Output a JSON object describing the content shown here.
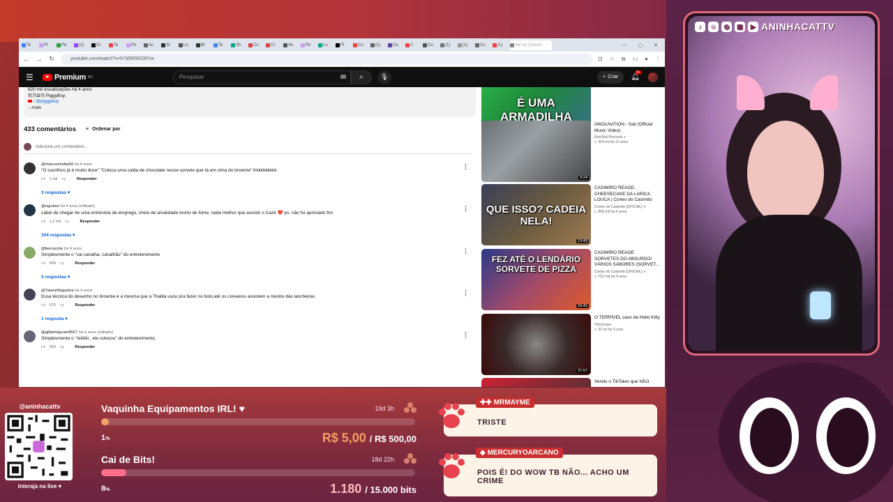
{
  "browser": {
    "tabs": [
      "Te",
      "Pl",
      "Pe",
      "(1)",
      "Gi",
      "Te",
      "Pe",
      "Ac",
      "St",
      "Lo",
      "Bl",
      "Te",
      "Sh",
      "Co",
      "Cr",
      "Ve",
      "Pe",
      "Lo",
      "Pi",
      "Co",
      "(1)",
      "Ce",
      "2:",
      "Co",
      "(1)",
      "(1)",
      "Co",
      "(1)"
    ],
    "active_tab": "Ver no Gemini",
    "url": "youtube.com/watch?v=h7d5R9XD9Yw"
  },
  "youtube": {
    "logo_text": "Premium",
    "logo_sup": "BR",
    "search_placeholder": "Pesquisar",
    "create_label": "Criar",
    "notif_badge": "9+",
    "description": {
      "views": "820 mil visualizações  há 4 anos",
      "line2": "피기보이 PiggyBoy:",
      "handle": "/ @piggyboy",
      "more": "...mais"
    },
    "comments_count": "433 comentários",
    "sort_label": "Ordenar por",
    "add_comment_placeholder": "Adicione um comentário...",
    "reply_label": "Responder",
    "comments": [
      {
        "author": "@marcosmotta94",
        "time": "há 4 anos",
        "text": "\"O sucrilhos já é muito doce\" \"Coloca uma calda de chocolate nesse sorvete que tá em cima do brownie\" Kkkkkkkkkk",
        "likes": "1 mil",
        "replies": "3 respostas"
      },
      {
        "author": "@ngcdavi",
        "time": "há 4 anos (editado)",
        "text": "cabei de chegar de uma entrevista de emprego, cheio de ansiedade morto de fome, nada melhor que assistir o Cazé ❤️ ps: não fui aprovado fml",
        "likes": "1,2 mil",
        "replies": "104 respostas"
      },
      {
        "author": "@bercacola",
        "time": "há 4 anos",
        "text": "Simplesmente o \"vai canalha, canalhão\" do entretenimento",
        "likes": "609",
        "replies": "3 respostas"
      },
      {
        "author": "@TaianeNogueira",
        "time": "há 4 anos",
        "text": "Essa técnica do desenho no brownie é a mesma que a Thalita usou pra fazer no bolo,até os coreanos assistem a mestre das lancheiras",
        "likes": "570",
        "replies": "1 resposta"
      },
      {
        "author": "@gilbertojunior8567",
        "time": "há 4 anos (editado)",
        "text": "Simplesmente o \"Aiiiiiiiii , ele colocou\" do entretenimento.",
        "likes": "554",
        "replies": ""
      }
    ],
    "recommendations": [
      {
        "title": "",
        "channel": "",
        "stats": "",
        "duration": "14:14",
        "thumb_text": "É UMA ARMADILHA"
      },
      {
        "title": "AWOLNATION - Sail (Official Music Video)",
        "channel": "Red Bull Records ✔",
        "stats": "▷ 364 mi  há 12 anos",
        "duration": "4:24",
        "thumb_text": ""
      },
      {
        "title": "CASIMIRO REAGE: CHEESECAKE DA LARICA LOUCA | Cortes do Casimito",
        "channel": "Cortes do Casimito [OFICIAL] ✔",
        "stats": "▷ 865 mil  há 4 anos",
        "duration": "13:43",
        "thumb_text": "QUE ISSO? CADEIA NELA!"
      },
      {
        "title": "CASIMIRO REAGE: SORVETES DO ABSURDO! VÁRIOS SABORES (SORVET...",
        "channel": "Cortes do Casimito [OFICIAL] ✔",
        "stats": "▷ 701 mil  há 4 anos",
        "duration": "16:41",
        "thumb_text": "FEZ ATÉ O LENDÁRIO SORVETE DE PIZZA"
      },
      {
        "title": "O TERRÍVEL caso da Hello Kitty",
        "channel": "Yinoscope",
        "stats": "▷ 32 mi  há 3 sem.",
        "duration": "37:57",
        "thumb_text": ""
      },
      {
        "title": "Vendo o TikToker que NÃO",
        "channel": "",
        "stats": "",
        "duration": "",
        "thumb_text": ""
      }
    ]
  },
  "stream": {
    "channel_name": "ANINHACATTV",
    "qr_handle": "@aninhacattv",
    "qr_caption": "Interaja na live ♥",
    "goals": [
      {
        "title": "Vaquinha Equipamentos IRL! ♥",
        "time": "19d 3h",
        "progress": 0.01,
        "pct": "1",
        "current": "R$ 5,00",
        "target": "/ R$ 500,00",
        "color": "#f0a266"
      },
      {
        "title": "Cai de Bits!",
        "time": "18d 22h",
        "progress": 0.08,
        "pct": "8",
        "current": "1.180",
        "target": "/ 15.000 bits",
        "color": "#ff6f8a"
      }
    ],
    "chat": [
      {
        "user": "MRMAYME",
        "message": "TRISTE"
      },
      {
        "user": "MERCURYOARCANO",
        "message": "POIS É! DO WOW TB NÃO... ACHO UM CRIME"
      }
    ]
  }
}
